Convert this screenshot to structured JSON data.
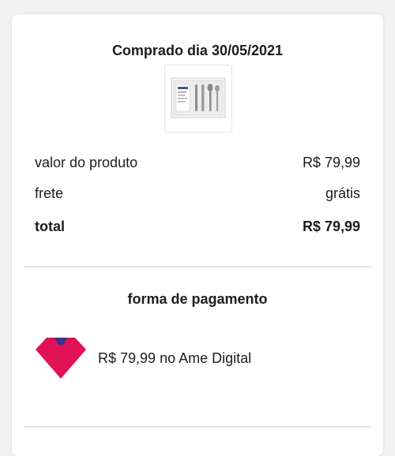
{
  "purchase": {
    "title": "Comprado dia 30/05/2021"
  },
  "summary": {
    "product_label": "valor do produto",
    "product_value": "R$ 79,99",
    "shipping_label": "frete",
    "shipping_value": "grátis",
    "total_label": "total",
    "total_value": "R$ 79,99"
  },
  "payment": {
    "title": "forma de pagamento",
    "amount": "R$ 79,99",
    "method": "no Ame Digital",
    "method_icon": "ame-digital-logo-icon"
  },
  "colors": {
    "ame_primary": "#e01155",
    "ame_accent": "#3b2e8f"
  }
}
